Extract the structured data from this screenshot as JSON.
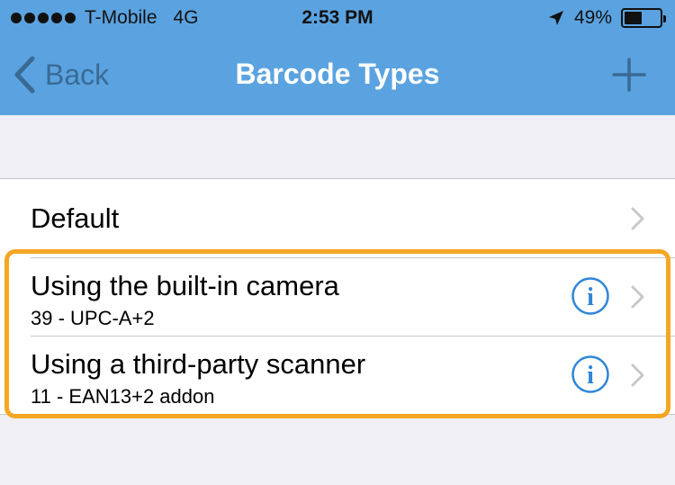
{
  "status_bar": {
    "carrier": "T-Mobile",
    "network": "4G",
    "time": "2:53 PM",
    "battery_percent": "49%",
    "battery_level": 0.49,
    "signal_icon": "signal-dots-icon",
    "location_icon": "location-arrow-icon",
    "battery_icon": "battery-icon"
  },
  "nav": {
    "back_label": "Back",
    "title": "Barcode Types",
    "add_icon": "plus-icon",
    "back_icon": "chevron-left-icon"
  },
  "list": {
    "items": [
      {
        "title": "Default",
        "subtitle": "",
        "has_info": false
      },
      {
        "title": "Using the built-in camera",
        "subtitle": "39 - UPC-A+2",
        "has_info": true
      },
      {
        "title": "Using a third-party scanner",
        "subtitle": "11 - EAN13+2 addon",
        "has_info": true
      }
    ]
  },
  "colors": {
    "nav_bar": "#5aa3e0",
    "background": "#efeff4",
    "info_accent": "#2f86d7",
    "highlight": "#f5a623",
    "chevron": "#c7c7cc"
  }
}
